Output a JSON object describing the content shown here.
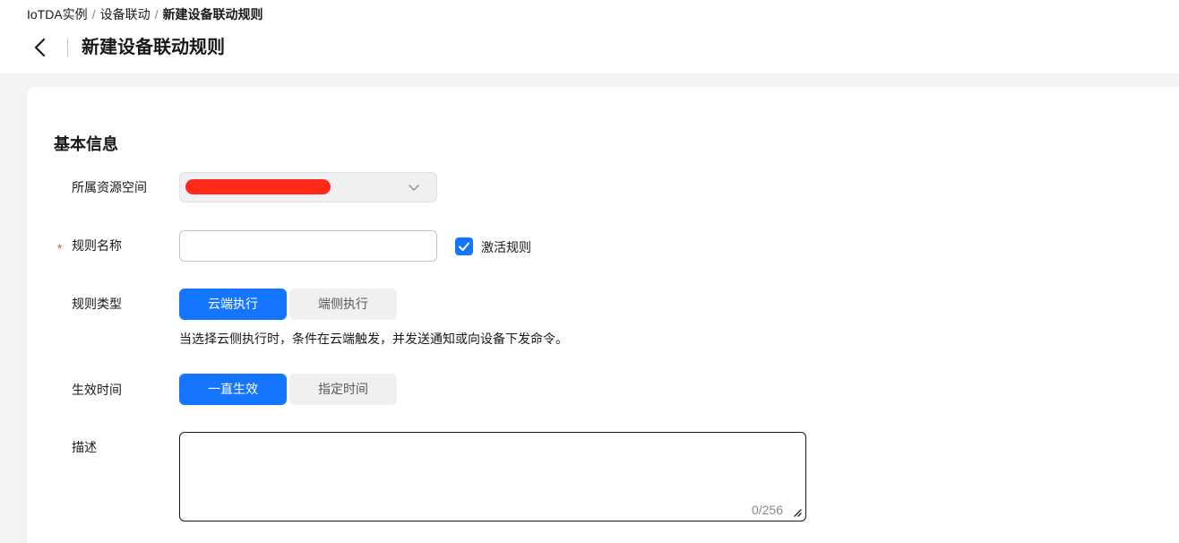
{
  "header": {
    "breadcrumb": [
      "IoTDA实例",
      "设备联动",
      "新建设备联动规则"
    ],
    "breadcrumb_separator": "/",
    "title": "新建设备联动规则"
  },
  "form": {
    "section_title": "基本信息",
    "resource_space": {
      "label": "所属资源空间",
      "value_redacted": true
    },
    "rule_name": {
      "label": "规则名称",
      "required_mark": "*",
      "value": "",
      "placeholder": "",
      "activate_label": "激活规则",
      "activate_checked": true
    },
    "rule_type": {
      "label": "规则类型",
      "options": [
        "云端执行",
        "端侧执行"
      ],
      "selected": "云端执行",
      "hint": "当选择云侧执行时，条件在云端触发，并发送通知或向设备下发命令。"
    },
    "effective_time": {
      "label": "生效时间",
      "options": [
        "一直生效",
        "指定时间"
      ],
      "selected": "一直生效"
    },
    "description": {
      "label": "描述",
      "value": "",
      "counter": "0/256"
    }
  },
  "colors": {
    "primary": "#1476ff",
    "required": "#e84e40",
    "redaction": "#ff2a1a",
    "page_background": "#f4f4f4"
  },
  "icons": {
    "back": "chevron-left-icon",
    "select": "chevron-down-icon",
    "checkbox": "checkmark-icon",
    "resize": "resize-handle-icon"
  }
}
